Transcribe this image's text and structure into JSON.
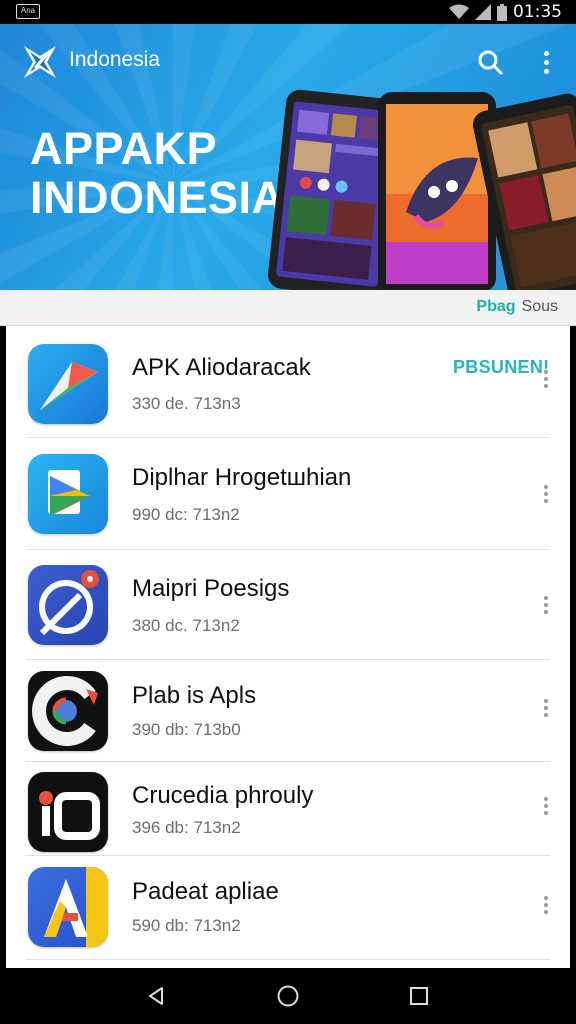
{
  "status_bar": {
    "time": "01:35",
    "notification_label": "Ana"
  },
  "header": {
    "brand": "Indonesia",
    "banner_title_line1": "APPAKP",
    "banner_title_line2": "INDONESIA"
  },
  "tab_strip": {
    "highlight": "Pbag",
    "label": "Sous"
  },
  "apps": [
    {
      "name": "APK Aliodaracak",
      "meta": "330 de. 713n3",
      "action": "PBSUNEN!",
      "icon": "paper-plane-icon"
    },
    {
      "name": "Diplhar Hrogetшhian",
      "meta": "990 dc: 713n2",
      "icon": "play-document-icon"
    },
    {
      "name": "Maipri Poesigs",
      "meta": "380 dc. 713n2",
      "icon": "chat-badge-icon"
    },
    {
      "name": "Plab is Apls",
      "meta": "390 db: 713b0",
      "icon": "chrome-ring-icon"
    },
    {
      "name": "Crucedia phrouly",
      "meta": "396 db: 713n2",
      "icon": "record-icon"
    },
    {
      "name": "Padeat apliae",
      "meta": "590 db: 713n2",
      "icon": "letter-a-icon"
    }
  ],
  "colors": {
    "banner": "#1e90dd",
    "accent": "#27b6b3"
  }
}
